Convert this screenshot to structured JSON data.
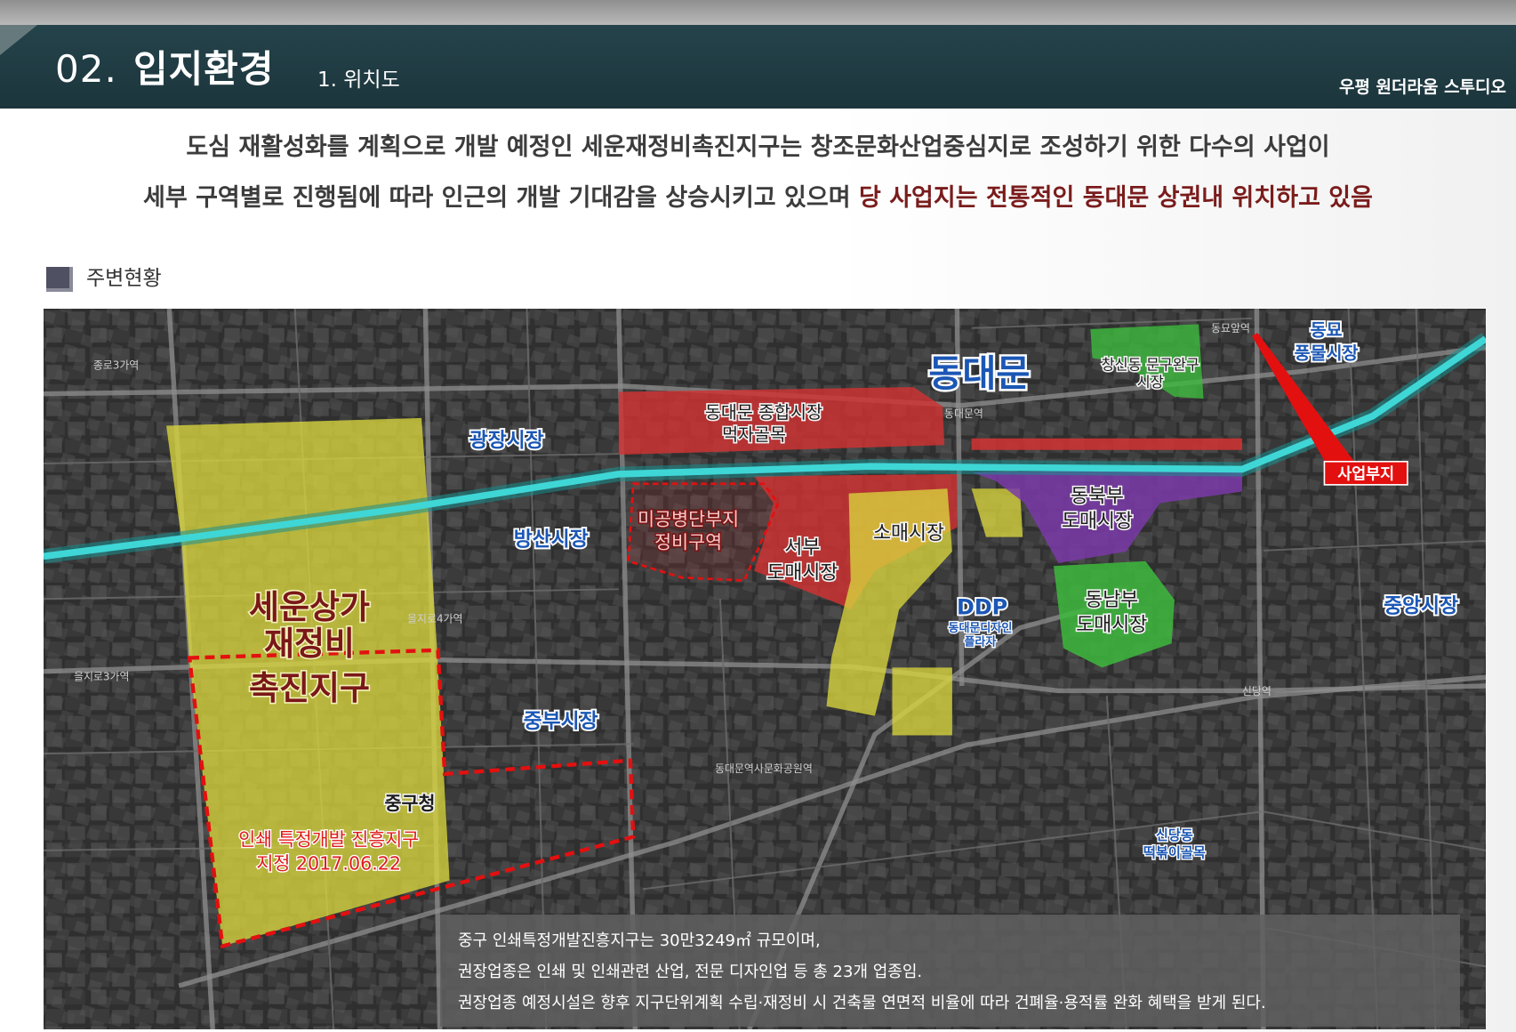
{
  "header": {
    "number": "02.",
    "title": "입지환경",
    "subtitle": "1. 위치도",
    "project_name": "우평 원더라움 스투디오"
  },
  "intro": {
    "line1": "도심 재활성화를 계획으로 개발 예정인 세운재정비촉진지구는 창조문화산업중심지로 조성하기 위한 다수의 사업이",
    "line2_plain": "세부 구역별로 진행됨에 따라 인근의 개발 기대감을 상승시키고 있으며 ",
    "line2_highlight": "당 사업지는 전통적인 동대문 상권내 위치하고 있음"
  },
  "section": {
    "title": "주변현황"
  },
  "map": {
    "labels": {
      "dongdaemun": "동대문",
      "gwangjang_market": "광장시장",
      "bangsan_market": "방산시장",
      "jungbu_market": "중부시장",
      "dongmyo_market": [
        "동묘",
        "풍물시장"
      ],
      "jungang_market": "중앙시장",
      "ddp": "DDP",
      "ddp_full": [
        "동대문디자인",
        "플라자"
      ],
      "sindang_tteokbokki": [
        "신당동",
        "떡볶이골목"
      ],
      "project_site": "사업부지",
      "jonghap_market": [
        "동대문 종합시장",
        "먹자골목"
      ],
      "migongbyeong": [
        "미공병단부지",
        "정비구역"
      ],
      "west_wholesale": [
        "서부",
        "도매시장"
      ],
      "retail_market": "소매시장",
      "northeast_wholesale": [
        "동북부",
        "도매시장"
      ],
      "southeast_wholesale": [
        "동남부",
        "도매시장"
      ],
      "changsin_stationery": [
        "창신동 문구완구",
        "시장"
      ],
      "sewoon": [
        "세운상가",
        "재정비",
        "촉진지구"
      ],
      "jung_gu_office": "중구청",
      "printing_district": [
        "인쇄 특정개발 진흥지구",
        "지정 2017.06.22"
      ]
    },
    "place_labels": [
      "종로3가역",
      "을지로3가역",
      "을지로4가역",
      "동대문역사문화공원역",
      "신당역",
      "동묘앞역",
      "동대문역"
    ],
    "info_box": {
      "lines": [
        "중구 인쇄특정개발진흥지구는 30만3249㎡ 규모이며,",
        "권장업종은 인쇄 및 인쇄관련 산업, 전문 디자인업 등 총 23개 업종임.",
        "권장업종 예정시설은 향후 지구단위계획 수립·재정비 시 건축물 연면적 비율에 따라 건폐율·용적률 완화 혜택을 받게 된다."
      ]
    }
  },
  "colors": {
    "header_bg": "#1f3a42",
    "highlight_text": "#7a1c1c",
    "zone_yellow": "#d9d63c",
    "zone_red": "#d23232",
    "zone_purple": "#7a3aa8",
    "zone_green": "#3dba3d",
    "stream_teal": "#3fd6d6",
    "label_blue": "#1b57b5"
  }
}
